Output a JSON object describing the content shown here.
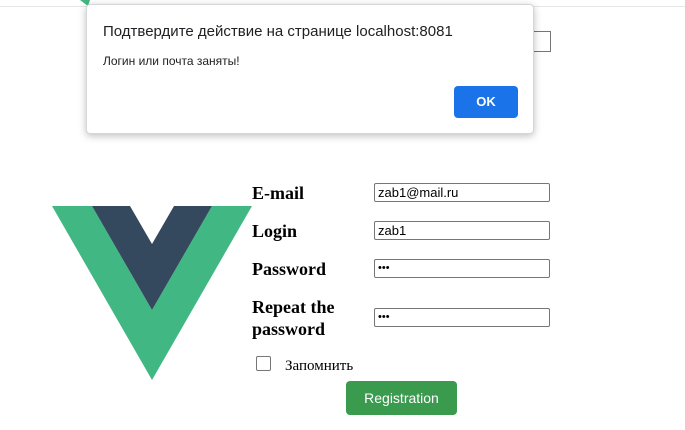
{
  "dialog": {
    "title": "Подтвердите действие на странице localhost:8081",
    "message": "Логин или почта заняты!",
    "ok_label": "OK"
  },
  "form": {
    "email_label": "E-mail",
    "email_value": "zab1@mail.ru",
    "login_label": "Login",
    "login_value": "zab1",
    "password_label": "Password",
    "password_value": "•••",
    "repeat_label": "Repeat the password",
    "repeat_value": "•••",
    "remember_label": "Запомнить",
    "remember_checked": false,
    "submit_label": "Registration"
  },
  "colors": {
    "vue_green": "#41b883",
    "vue_dark": "#34495e",
    "submit_button": "#3a9b4e",
    "ok_button": "#1a73e8"
  },
  "icons": {
    "logo": "vue-logo-icon"
  }
}
